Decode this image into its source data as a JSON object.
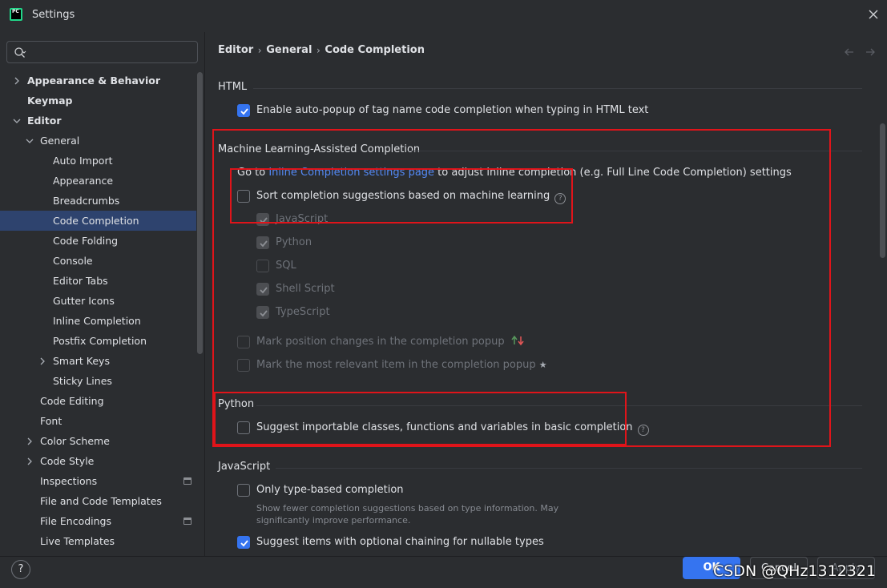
{
  "window": {
    "title": "Settings",
    "app_logo_text": "PC"
  },
  "search": {
    "placeholder": "",
    "value": ""
  },
  "sidebar": {
    "items": [
      {
        "label": "Appearance & Behavior",
        "level": 0,
        "bold": true,
        "chevron": "right"
      },
      {
        "label": "Keymap",
        "level": 0,
        "bold": true,
        "chevron": ""
      },
      {
        "label": "Editor",
        "level": 0,
        "bold": true,
        "chevron": "down"
      },
      {
        "label": "General",
        "level": 1,
        "bold": false,
        "chevron": "down"
      },
      {
        "label": "Auto Import",
        "level": 2,
        "bold": false,
        "chevron": ""
      },
      {
        "label": "Appearance",
        "level": 2,
        "bold": false,
        "chevron": ""
      },
      {
        "label": "Breadcrumbs",
        "level": 2,
        "bold": false,
        "chevron": ""
      },
      {
        "label": "Code Completion",
        "level": 2,
        "bold": false,
        "chevron": "",
        "selected": true
      },
      {
        "label": "Code Folding",
        "level": 2,
        "bold": false,
        "chevron": ""
      },
      {
        "label": "Console",
        "level": 2,
        "bold": false,
        "chevron": ""
      },
      {
        "label": "Editor Tabs",
        "level": 2,
        "bold": false,
        "chevron": ""
      },
      {
        "label": "Gutter Icons",
        "level": 2,
        "bold": false,
        "chevron": ""
      },
      {
        "label": "Inline Completion",
        "level": 2,
        "bold": false,
        "chevron": ""
      },
      {
        "label": "Postfix Completion",
        "level": 2,
        "bold": false,
        "chevron": ""
      },
      {
        "label": "Smart Keys",
        "level": 2,
        "bold": false,
        "chevron": "right"
      },
      {
        "label": "Sticky Lines",
        "level": 2,
        "bold": false,
        "chevron": ""
      },
      {
        "label": "Code Editing",
        "level": 1,
        "bold": false,
        "chevron": ""
      },
      {
        "label": "Font",
        "level": 1,
        "bold": false,
        "chevron": ""
      },
      {
        "label": "Color Scheme",
        "level": 1,
        "bold": false,
        "chevron": "right"
      },
      {
        "label": "Code Style",
        "level": 1,
        "bold": false,
        "chevron": "right"
      },
      {
        "label": "Inspections",
        "level": 1,
        "bold": false,
        "chevron": "",
        "badge": true
      },
      {
        "label": "File and Code Templates",
        "level": 1,
        "bold": false,
        "chevron": ""
      },
      {
        "label": "File Encodings",
        "level": 1,
        "bold": false,
        "chevron": "",
        "badge": true
      },
      {
        "label": "Live Templates",
        "level": 1,
        "bold": false,
        "chevron": ""
      }
    ]
  },
  "breadcrumb": [
    "Editor",
    "General",
    "Code Completion"
  ],
  "sections": {
    "html": {
      "title": "HTML",
      "options": [
        {
          "label": "Enable auto-popup of tag name code completion when typing in HTML text",
          "checked": true
        }
      ]
    },
    "ml": {
      "title": "Machine Learning-Assisted Completion",
      "info_prefix": "Go to ",
      "info_link": "Inline Completion settings page",
      "info_suffix": " to adjust inline completion (e.g. Full Line Code Completion) settings",
      "sort_option": {
        "label": "Sort completion suggestions based on machine learning",
        "checked": false
      },
      "languages": [
        {
          "label": "JavaScript",
          "checked": true
        },
        {
          "label": "Python",
          "checked": true
        },
        {
          "label": "SQL",
          "checked": false
        },
        {
          "label": "Shell Script",
          "checked": true
        },
        {
          "label": "TypeScript",
          "checked": true
        }
      ],
      "mark_position": {
        "label": "Mark position changes in the completion popup",
        "checked": false
      },
      "mark_relevant": {
        "label": "Mark the most relevant item in the completion popup",
        "checked": false
      }
    },
    "python": {
      "title": "Python",
      "options": [
        {
          "label": "Suggest importable classes, functions and variables in basic completion",
          "checked": false
        }
      ]
    },
    "javascript": {
      "title": "JavaScript",
      "type_based": {
        "label": "Only type-based completion",
        "checked": false
      },
      "type_based_hint_1": "Show fewer completion suggestions based on type information. May",
      "type_based_hint_2": "significantly improve performance.",
      "optional_chaining": {
        "label": "Suggest items with optional chaining for nullable types",
        "checked": true
      }
    }
  },
  "footer": {
    "help": "?",
    "ok": "OK",
    "cancel": "Cancel",
    "apply": "Apply",
    "watermark": "CSDN @QHz1312321"
  },
  "colors": {
    "accent": "#3574f0",
    "selected": "#2e436e",
    "link": "#548af7",
    "annotation": "#e0141a"
  }
}
